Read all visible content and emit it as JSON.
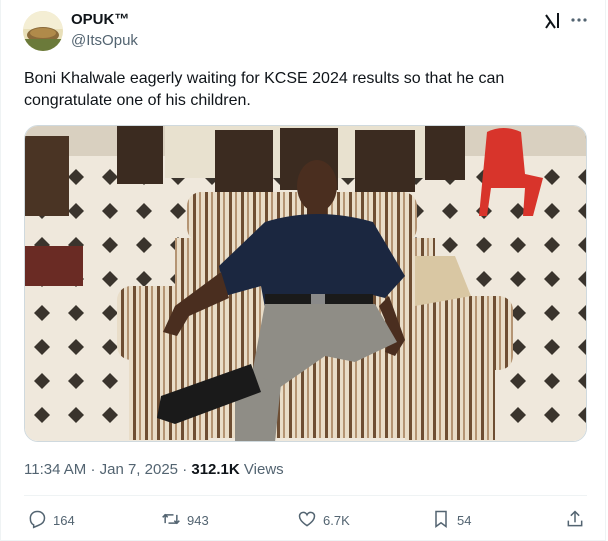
{
  "author": {
    "name": "OPUK™",
    "handle": "@ItsOpuk"
  },
  "tweet": {
    "text": "Boni Khalwale eagerly waiting for KCSE 2024 results so that he can congratulate one of his children."
  },
  "meta": {
    "time": "11:34 AM",
    "date": "Jan 7, 2025",
    "views_count": "312.1K",
    "views_label": "Views",
    "separator": "·"
  },
  "actions": {
    "replies": "164",
    "reposts": "943",
    "likes": "6.7K",
    "bookmarks": "54"
  },
  "icons": [
    "grok-icon",
    "more-icon",
    "reply-icon",
    "repost-icon",
    "like-icon",
    "bookmark-icon",
    "share-icon"
  ],
  "colors": {
    "text": "#0f1419",
    "secondary": "#536471",
    "border": "#eff3f4"
  }
}
